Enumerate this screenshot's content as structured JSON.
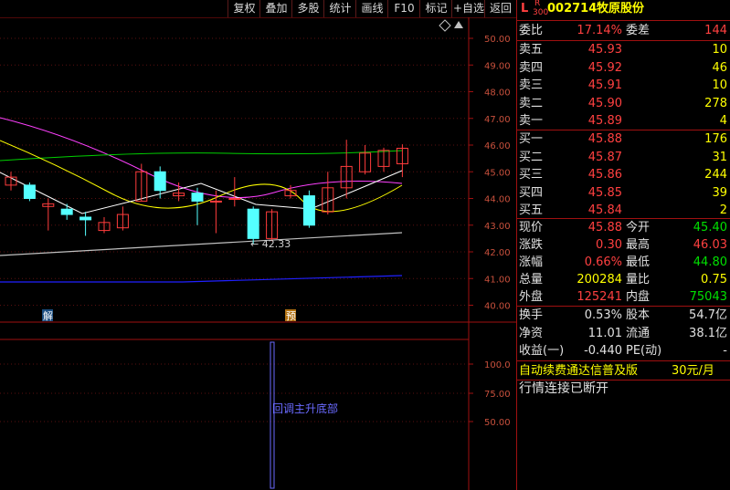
{
  "toolbar": {
    "buttons": [
      "复权",
      "叠加",
      "多股",
      "统计",
      "画线",
      "F10",
      "标记",
      "+自选",
      "返回"
    ]
  },
  "price_axis": {
    "labels": [
      "50.00",
      "49.00",
      "48.00",
      "47.00",
      "46.00",
      "45.00",
      "44.00",
      "43.00",
      "42.00",
      "41.00",
      "40.00"
    ]
  },
  "indicator_axis": {
    "labels": [
      "100.0",
      "75.00",
      "50.00"
    ]
  },
  "chart": {
    "low_marker_text": "← 42.33",
    "badge_jie": "解",
    "badge_yu": "预",
    "signal_label": "回调主升底部",
    "candles": [
      {
        "o": 44.5,
        "c": 44.8,
        "h": 45.0,
        "l": 44.3
      },
      {
        "o": 44.5,
        "c": 44.0,
        "h": 44.6,
        "l": 43.9
      },
      {
        "o": 43.7,
        "c": 43.8,
        "h": 44.0,
        "l": 42.8
      },
      {
        "o": 43.6,
        "c": 43.4,
        "h": 43.8,
        "l": 43.2
      },
      {
        "o": 43.3,
        "c": 43.2,
        "h": 43.5,
        "l": 42.6
      },
      {
        "o": 42.8,
        "c": 43.1,
        "h": 43.3,
        "l": 42.7
      },
      {
        "o": 42.9,
        "c": 43.4,
        "h": 43.7,
        "l": 42.8
      },
      {
        "o": 43.9,
        "c": 45.0,
        "h": 45.3,
        "l": 43.9
      },
      {
        "o": 45.0,
        "c": 44.3,
        "h": 45.2,
        "l": 44.0
      },
      {
        "o": 44.1,
        "c": 44.2,
        "h": 44.6,
        "l": 43.9
      },
      {
        "o": 44.2,
        "c": 43.9,
        "h": 44.4,
        "l": 43.0
      },
      {
        "o": 43.9,
        "c": 43.9,
        "h": 44.3,
        "l": 42.7
      },
      {
        "o": 44.0,
        "c": 44.0,
        "h": 44.8,
        "l": 43.7
      },
      {
        "o": 43.6,
        "c": 42.5,
        "h": 43.7,
        "l": 42.3
      },
      {
        "o": 42.5,
        "c": 43.5,
        "h": 43.6,
        "l": 42.4
      },
      {
        "o": 44.1,
        "c": 44.3,
        "h": 44.5,
        "l": 44.0
      },
      {
        "o": 44.1,
        "c": 43.0,
        "h": 44.3,
        "l": 42.9
      },
      {
        "o": 43.5,
        "c": 44.4,
        "h": 45.0,
        "l": 43.4
      },
      {
        "o": 44.4,
        "c": 45.2,
        "h": 46.2,
        "l": 44.0
      },
      {
        "o": 45.0,
        "c": 45.7,
        "h": 46.0,
        "l": 44.9
      },
      {
        "o": 45.2,
        "c": 45.8,
        "h": 45.9,
        "l": 45.0
      },
      {
        "o": 45.3,
        "c": 45.88,
        "h": 46.03,
        "l": 44.8
      }
    ]
  },
  "quote": {
    "market_code": "L",
    "sub_r": "R",
    "sub_300": "300",
    "code": "002714",
    "name": "牧原股份",
    "webi_label": "委比",
    "webi_value": "17.14%",
    "wecha_label": "委差",
    "wecha_value": "144",
    "asks": [
      {
        "label": "卖五",
        "price": "45.93",
        "vol": "10"
      },
      {
        "label": "卖四",
        "price": "45.92",
        "vol": "46"
      },
      {
        "label": "卖三",
        "price": "45.91",
        "vol": "10"
      },
      {
        "label": "卖二",
        "price": "45.90",
        "vol": "278"
      },
      {
        "label": "卖一",
        "price": "45.89",
        "vol": "4"
      }
    ],
    "bids": [
      {
        "label": "买一",
        "price": "45.88",
        "vol": "176"
      },
      {
        "label": "买二",
        "price": "45.87",
        "vol": "31"
      },
      {
        "label": "买三",
        "price": "45.86",
        "vol": "244"
      },
      {
        "label": "买四",
        "price": "45.85",
        "vol": "39"
      },
      {
        "label": "买五",
        "price": "45.84",
        "vol": "2"
      }
    ],
    "stats": [
      {
        "l1": "现价",
        "v1": "45.88",
        "c1": "red",
        "l2": "今开",
        "v2": "45.40",
        "c2": "grn"
      },
      {
        "l1": "涨跌",
        "v1": "0.30",
        "c1": "red",
        "l2": "最高",
        "v2": "46.03",
        "c2": "red"
      },
      {
        "l1": "涨幅",
        "v1": "0.66%",
        "c1": "red",
        "l2": "最低",
        "v2": "44.80",
        "c2": "grn"
      },
      {
        "l1": "总量",
        "v1": "200284",
        "c1": "yel",
        "l2": "量比",
        "v2": "0.75",
        "c2": "yel"
      },
      {
        "l1": "外盘",
        "v1": "125241",
        "c1": "red",
        "l2": "内盘",
        "v2": "75043",
        "c2": "grn"
      }
    ],
    "info": [
      {
        "l1": "换手",
        "v1": "0.53%",
        "l2": "股本",
        "v2": "54.7亿"
      },
      {
        "l1": "净资",
        "v1": "11.01",
        "l2": "流通",
        "v2": "38.1亿"
      },
      {
        "l1": "收益(一)",
        "v1": "-0.440",
        "l2": "PE(动)",
        "v2": "-"
      }
    ],
    "ad_text": "自动续费通达信普及版",
    "ad_price": "30元/月",
    "status_text": "行情连接已断开"
  },
  "colors": {
    "up": "#ff3c3c",
    "down": "#54ffff",
    "ma_white": "#ffffff",
    "ma_yellow": "#ffff00",
    "ma_magenta": "#ff40ff",
    "ma_green": "#00d000",
    "ma_gray": "#c0c0c0",
    "ma_blue": "#2020ff",
    "frame": "#a01010"
  }
}
